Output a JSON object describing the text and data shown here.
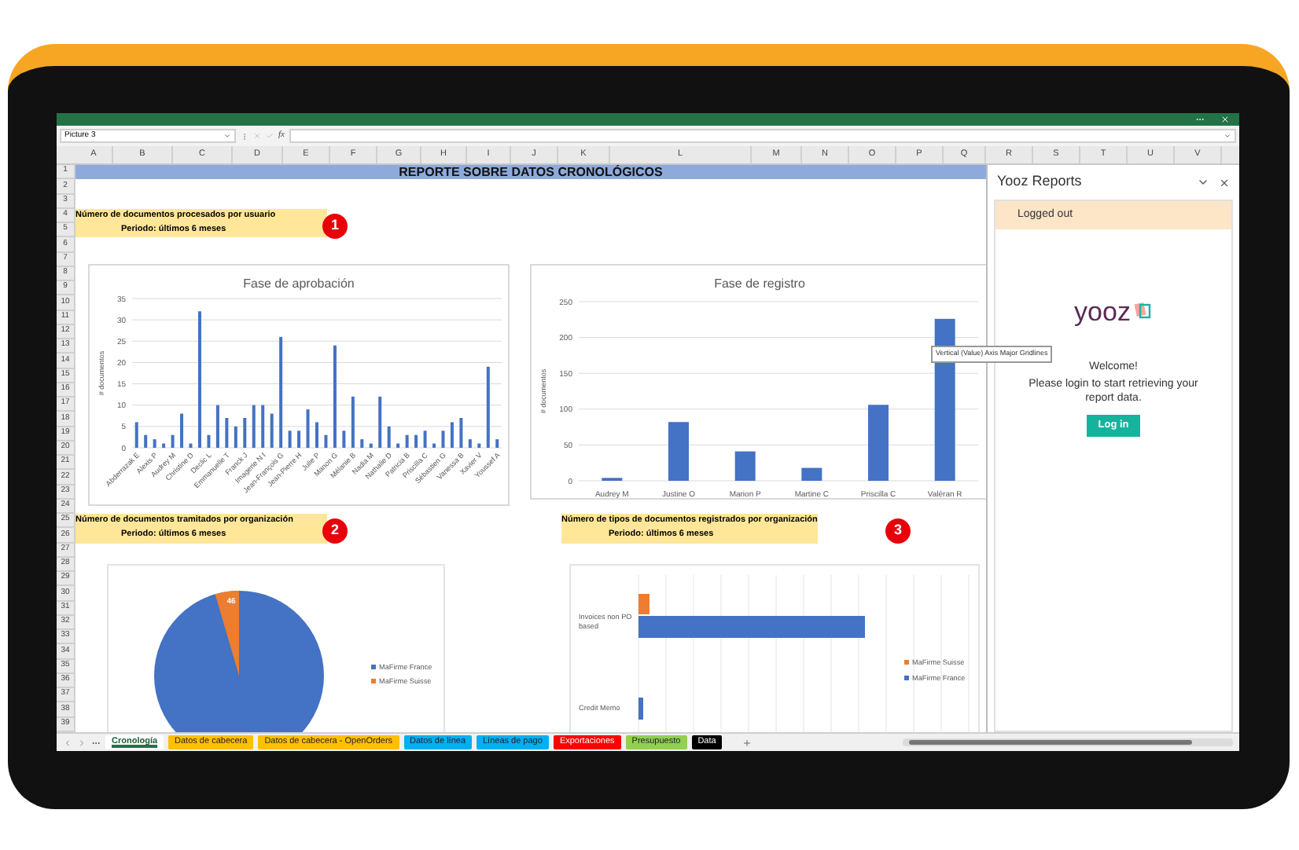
{
  "formula_bar": {
    "name_box": "Picture 3",
    "function_label": "fx"
  },
  "columns": [
    "A",
    "B",
    "C",
    "D",
    "E",
    "F",
    "G",
    "H",
    "I",
    "J",
    "K",
    "L",
    "M",
    "N",
    "O",
    "P",
    "Q",
    "R",
    "S",
    "T",
    "U",
    "V"
  ],
  "row_numbers": [
    "1",
    "2",
    "3",
    "4",
    "5",
    "6",
    "7",
    "8",
    "9",
    "10",
    "11",
    "12",
    "13",
    "14",
    "15",
    "16",
    "17",
    "18",
    "19",
    "20",
    "21",
    "22",
    "23",
    "24",
    "25",
    "26",
    "27",
    "28",
    "29",
    "30",
    "31",
    "32",
    "33",
    "34",
    "35",
    "36",
    "37",
    "38",
    "39"
  ],
  "report_title": "REPORTE SOBRE DATOS CRONOLÓGICOS",
  "sections": [
    {
      "line1": "Número de documentos procesados por usuario",
      "line2": "Periodo: últimos 6 meses",
      "badge": "1"
    },
    {
      "line1": "Número de documentos tramitados por organización",
      "line2": "Periodo: últimos 6 meses",
      "badge": "2"
    },
    {
      "line1": "Número de tipos de documentos registrados por organización",
      "line2": "Periodo: últimos 6 meses",
      "badge": "3"
    }
  ],
  "approval_chart": {
    "chart_data": {
      "type": "bar",
      "title": "Fase de aprobación",
      "ylabel": "# documentos",
      "ylim": [
        0,
        35
      ],
      "yticks": [
        0,
        5,
        10,
        15,
        20,
        25,
        30,
        35
      ],
      "grid": true,
      "categories": [
        "Abderrazak E",
        null,
        "Alexis P",
        null,
        "Audrey M",
        null,
        "Christine D",
        null,
        "Declic L",
        null,
        "Emmanuelle T",
        null,
        "Franck J",
        null,
        "Imagerie N I",
        null,
        "Jean-François G",
        null,
        "Jean-Pierre H",
        null,
        "Julie P",
        null,
        "Manon G",
        null,
        "Mélanie B",
        null,
        "Nadia M",
        null,
        "Nathalie D",
        null,
        "Patricia B",
        null,
        "Priscilla C",
        null,
        "Sébastien G",
        null,
        "Vanessa B",
        null,
        "Xavier V",
        null,
        "Youssef A"
      ],
      "series": [
        {
          "color": "#4472c4",
          "values": [
            6,
            3,
            2,
            1,
            3,
            8,
            1,
            32,
            3,
            10,
            7,
            5,
            7,
            10,
            10,
            8,
            26,
            4,
            4,
            9,
            6,
            3,
            24,
            4,
            12,
            2,
            1,
            12,
            5,
            1,
            3,
            3,
            4,
            1,
            4,
            6,
            7,
            2,
            1,
            19,
            2
          ]
        }
      ]
    }
  },
  "registration_chart": {
    "chart_data": {
      "type": "bar",
      "title": "Fase de registro",
      "ylabel": "# documentos",
      "ylim": [
        0,
        250
      ],
      "yticks": [
        0,
        50,
        100,
        150,
        200,
        250
      ],
      "grid": true,
      "categories": [
        "Audrey M",
        "Justine O",
        "Marion P",
        "Martine C",
        "Priscilla C",
        "Valéran R"
      ],
      "series": [
        {
          "color": "#4472c4",
          "values": [
            4,
            82,
            41,
            18,
            106,
            226
          ]
        }
      ]
    }
  },
  "organization_pie": {
    "slice_label": "46",
    "legend": [
      {
        "name": "MaFirme France",
        "color": "#4472c4"
      },
      {
        "name": "MaFirme Suisse",
        "color": "#ed7d31"
      }
    ]
  },
  "document_types_chart": {
    "categories": [
      "Invoices non PO based",
      "Credit Memo"
    ],
    "legend": [
      {
        "name": "MaFirme Suisse",
        "color": "#ed7d31"
      },
      {
        "name": "MaFirme France",
        "color": "#4472c4"
      }
    ]
  },
  "tooltip": "Vertical (Value) Axis Major Gridlines",
  "panel": {
    "title": "Yooz Reports",
    "status": "Logged out",
    "logo_text": "yooz",
    "welcome": "Welcome!",
    "message": "Please login to start retrieving your report data.",
    "login_button": "Log in"
  },
  "sheet_tabs": [
    {
      "label": "Cronología",
      "color": "#ffffff",
      "selected": true
    },
    {
      "label": "Datos de cabecera",
      "color": "#ffc000",
      "selected": false
    },
    {
      "label": "Datos de cabecera - OpenOrders",
      "color": "#ffc000",
      "selected": false
    },
    {
      "label": "Datos de línea",
      "color": "#00b0f0",
      "selected": false
    },
    {
      "label": "Líneas de pago",
      "color": "#00b0f0",
      "selected": false
    },
    {
      "label": "Exportaciones",
      "color": "#ff0000",
      "selected": false
    },
    {
      "label": "Presupuesto",
      "color": "#92d050",
      "selected": false
    },
    {
      "label": "Data",
      "color": "#000000",
      "selected": false
    }
  ]
}
